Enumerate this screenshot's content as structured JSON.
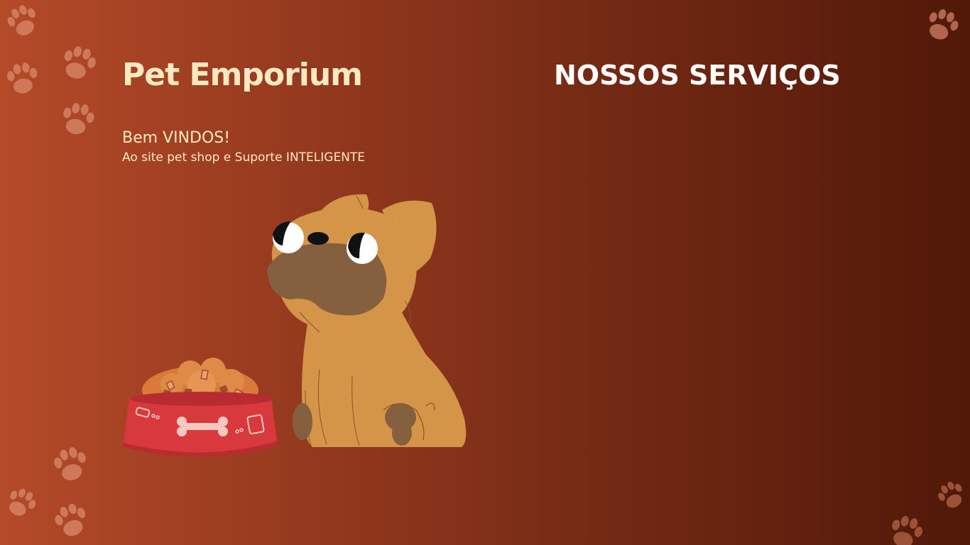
{
  "header": {
    "brand": "Pet Emporium",
    "services_title": "NOSSOS SERVIÇOS"
  },
  "hero": {
    "welcome": "Bem VINDOS!",
    "subtitle": "Ao site pet shop e Suporte INTELIGENTE"
  },
  "decorations": {
    "icon": "paw-print-icon",
    "illustration": "pug-with-food-bowl-illustration"
  },
  "colors": {
    "background_start": "#b44a28",
    "background_end": "#511808",
    "brand_text": "#fbe9c2",
    "title_text": "#ffffff"
  }
}
